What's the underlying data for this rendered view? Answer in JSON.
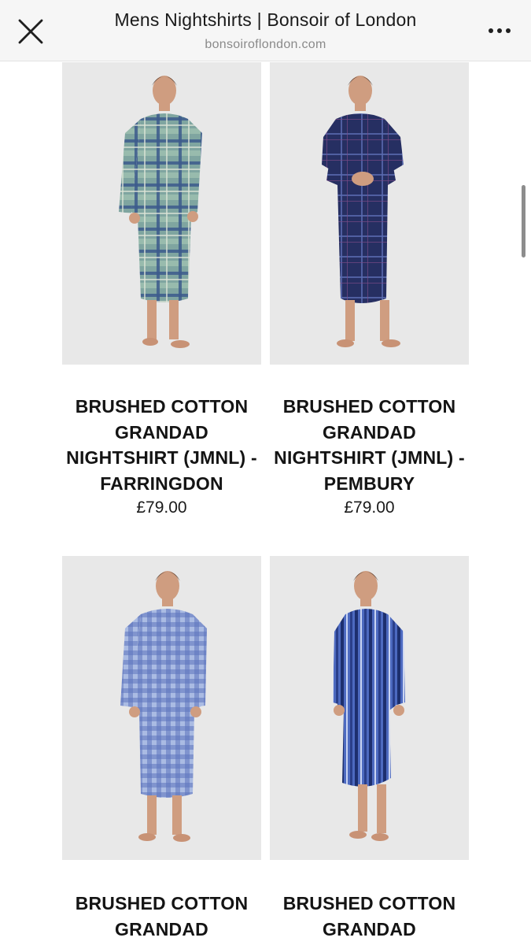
{
  "browser": {
    "title": "Mens Nightshirts | Bonsoir of London",
    "url": "bonsoiroflondon.com",
    "close_icon": "close-icon",
    "more_icon": "more-icon"
  },
  "products": [
    {
      "title": "BRUSHED COTTON GRANDAD NIGHTSHIRT (JMNL) - FARRINGDON",
      "price": "£79.00",
      "pattern": "green-blue tartan",
      "color": "#6f93a0"
    },
    {
      "title": "BRUSHED COTTON GRANDAD NIGHTSHIRT (JMNL) - PEMBURY",
      "price": "£79.00",
      "pattern": "navy check",
      "color": "#2b3566"
    },
    {
      "title": "BRUSHED COTTON GRANDAD",
      "price": "",
      "pattern": "blue gingham",
      "color": "#6f86c4"
    },
    {
      "title": "BRUSHED COTTON GRANDAD",
      "price": "",
      "pattern": "blue stripe",
      "color": "#4161b3"
    }
  ]
}
